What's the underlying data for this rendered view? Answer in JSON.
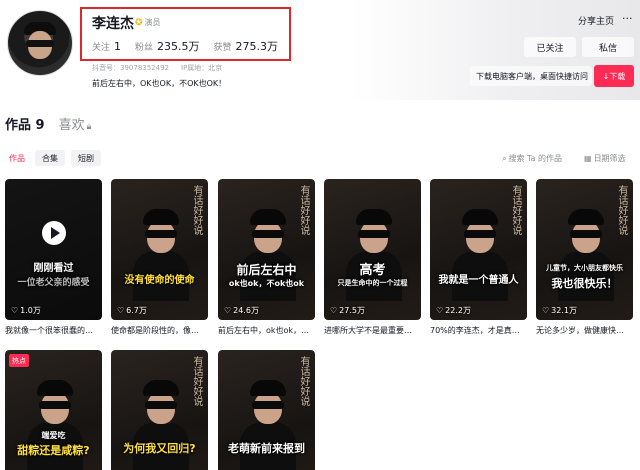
{
  "profile": {
    "name": "李连杰",
    "verify_label": "演员",
    "following_label": "关注",
    "following_value": "1",
    "fans_label": "粉丝",
    "fans_value": "235.5万",
    "likes_label": "获赞",
    "likes_value": "275.3万",
    "id_text": "抖音号：39078352492",
    "ip_text": "IP属地：北京",
    "bio": "前后左右中，OK也OK，不OK也OK！"
  },
  "actions": {
    "share": "分享主页",
    "more": "···",
    "followed": "已关注",
    "message": "私信",
    "download_tip": "下载电脑客户端，桌面快捷访问",
    "download_btn": "↓下载"
  },
  "tabs": [
    {
      "label": "作品 9"
    },
    {
      "label": "喜欢"
    }
  ],
  "subtabs": [
    {
      "label": "作品"
    },
    {
      "label": "合集"
    },
    {
      "label": "短剧"
    }
  ],
  "search_placeholder": "搜索 Ta 的作品",
  "sort_label": "日期筛选",
  "videos": [
    {
      "caption": "刚刚看过",
      "caption2": "一位老父亲的感受",
      "likes": "1.0万",
      "title": "我就像一个很笨很蠢的…"
    },
    {
      "caption": "没有使命的使命",
      "likes": "6.7万",
      "title": "使命都是阶段性的，像…"
    },
    {
      "caption": "前后左右中",
      "caption2": "ok也ok，不ok也ok",
      "likes": "24.6万",
      "title": "前后左右中，ok也ok，…"
    },
    {
      "caption": "高考",
      "caption2": "只是生命中的一个过程",
      "likes": "27.5万",
      "title": "进哪所大学不是最重要…"
    },
    {
      "caption": "我就是一个普通人",
      "likes": "22.2万",
      "title": "70%的李连杰，才是真…"
    },
    {
      "caption": "儿童节，大小朋友都快乐",
      "caption2": "我也很快乐！",
      "likes": "32.1万",
      "title": "无论多少岁，做健康快…"
    },
    {
      "hot": "热点",
      "caption": "甜粽还是咸粽?",
      "caption_top": "端爱吃"
    },
    {
      "caption": "为何我又回归?"
    },
    {
      "caption": "老萌新前来报到"
    }
  ],
  "watermark": "有话好好说",
  "colors": {
    "accent": "#fe2c55",
    "highlight_box": "#e0262b"
  }
}
